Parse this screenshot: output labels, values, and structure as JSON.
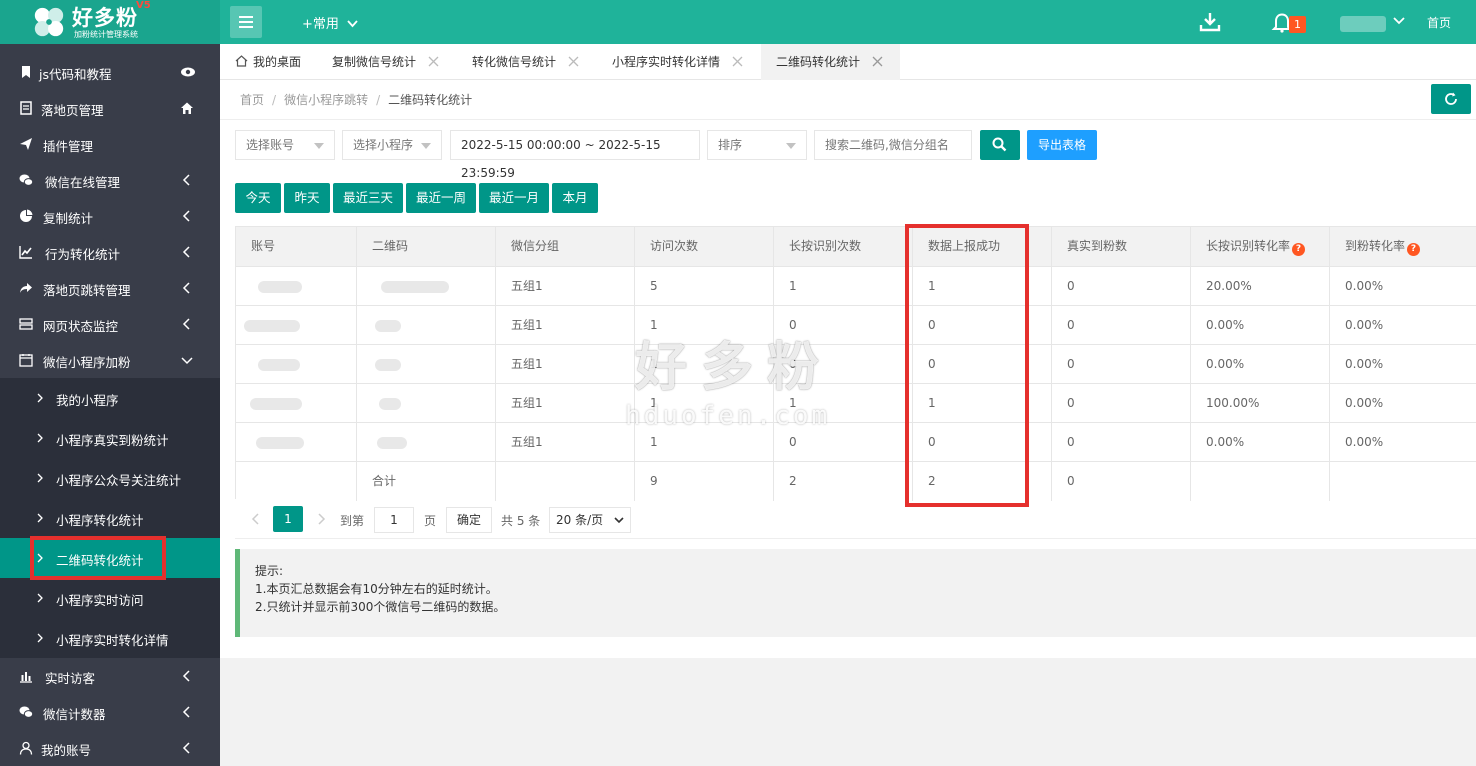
{
  "app": {
    "logo_title": "好多粉",
    "logo_version": "V5",
    "logo_subtitle": "加粉统计管理系统",
    "colors": {
      "brand": "#1fb39a",
      "primary": "#009688",
      "blue": "#1e9fff",
      "badge": "#ff5722",
      "sidebar": "#393d49",
      "highlight": "#e5302d"
    }
  },
  "topbar": {
    "common_label": "+常用",
    "notification_count": "1",
    "home_label": "首页",
    "icons": [
      "menu-icon",
      "download-icon",
      "bell-icon",
      "chevron-down-icon"
    ]
  },
  "sidebar": {
    "items": [
      {
        "label": "js代码和教程",
        "icon": "bookmark-icon",
        "right": "eye-icon"
      },
      {
        "label": "落地页管理",
        "icon": "page-icon",
        "right": "home-icon"
      },
      {
        "label": "插件管理",
        "icon": "send-icon",
        "right": ""
      },
      {
        "label": "微信在线管理",
        "icon": "wechat-icon",
        "right": "chevron-left-icon"
      },
      {
        "label": "复制统计",
        "icon": "pie-chart-icon",
        "right": "chevron-left-icon"
      },
      {
        "label": "行为转化统计",
        "icon": "line-chart-icon",
        "right": "chevron-left-icon"
      },
      {
        "label": "落地页跳转管理",
        "icon": "share-icon",
        "right": "chevron-left-icon"
      },
      {
        "label": "网页状态监控",
        "icon": "server-icon",
        "right": "chevron-left-icon"
      },
      {
        "label": "微信小程序加粉",
        "icon": "calendar-icon",
        "right": "chevron-down-icon"
      }
    ],
    "sub_items": [
      {
        "label": "我的小程序"
      },
      {
        "label": "小程序真实到粉统计"
      },
      {
        "label": "小程序公众号关注统计"
      },
      {
        "label": "小程序转化统计"
      },
      {
        "label": "二维码转化统计"
      },
      {
        "label": "小程序实时访问"
      },
      {
        "label": "小程序实时转化详情"
      }
    ],
    "bottom_items": [
      {
        "label": "实时访客",
        "icon": "bar-chart-icon",
        "right": "chevron-left-icon"
      },
      {
        "label": "微信计数器",
        "icon": "wechat-icon",
        "right": "chevron-left-icon"
      },
      {
        "label": "我的账号",
        "icon": "user-icon",
        "right": "chevron-left-icon"
      }
    ]
  },
  "tabs": [
    {
      "label": "我的桌面"
    },
    {
      "label": "复制微信号统计"
    },
    {
      "label": "转化微信号统计"
    },
    {
      "label": "小程序实时转化详情"
    },
    {
      "label": "二维码转化统计"
    }
  ],
  "breadcrumb": {
    "home": "首页",
    "parent": "微信小程序跳转",
    "current": "二维码转化统计",
    "sep": "/"
  },
  "filters": {
    "account_placeholder": "选择账号",
    "miniprogram_placeholder": "选择小程序",
    "date_range": "2022-5-15 00:00:00 ~ 2022-5-15 23:59:59",
    "sort_placeholder": "排序",
    "search_placeholder": "搜索二维码,微信分组名",
    "export_label": "导出表格"
  },
  "quick_ranges": [
    "今天",
    "昨天",
    "最近三天",
    "最近一周",
    "最近一月",
    "本月"
  ],
  "table": {
    "headers": [
      "账号",
      "二维码",
      "微信分组",
      "访问次数",
      "长按识别次数",
      "数据上报成功",
      "真实到粉数",
      "长按识别转化率",
      "到粉转化率"
    ],
    "rows": [
      [
        "",
        "",
        "五组1",
        "5",
        "1",
        "1",
        "0",
        "20.00%",
        "0.00%"
      ],
      [
        "",
        "",
        "五组1",
        "1",
        "0",
        "0",
        "0",
        "0.00%",
        "0.00%"
      ],
      [
        "",
        "",
        "五组1",
        "1",
        "0",
        "0",
        "0",
        "0.00%",
        "0.00%"
      ],
      [
        "",
        "",
        "五组1",
        "1",
        "1",
        "1",
        "0",
        "100.00%",
        "0.00%"
      ],
      [
        "",
        "",
        "五组1",
        "1",
        "0",
        "0",
        "0",
        "0.00%",
        "0.00%"
      ]
    ],
    "total_row": [
      "",
      "合计",
      "",
      "9",
      "2",
      "2",
      "0",
      "",
      ""
    ]
  },
  "pagination": {
    "current_page": "1",
    "goto_label": "到第",
    "page_input": "1",
    "page_unit": "页",
    "confirm_label": "确定",
    "total_label": "共 5 条",
    "page_size": "20 条/页"
  },
  "tips": {
    "title": "提示:",
    "lines": [
      "1.本页汇总数据会有10分钟左右的延时统计。",
      "2.只统计并显示前300个微信号二维码的数据。"
    ]
  },
  "watermark": {
    "cn": "好多粉",
    "en": "hduofen.com"
  }
}
